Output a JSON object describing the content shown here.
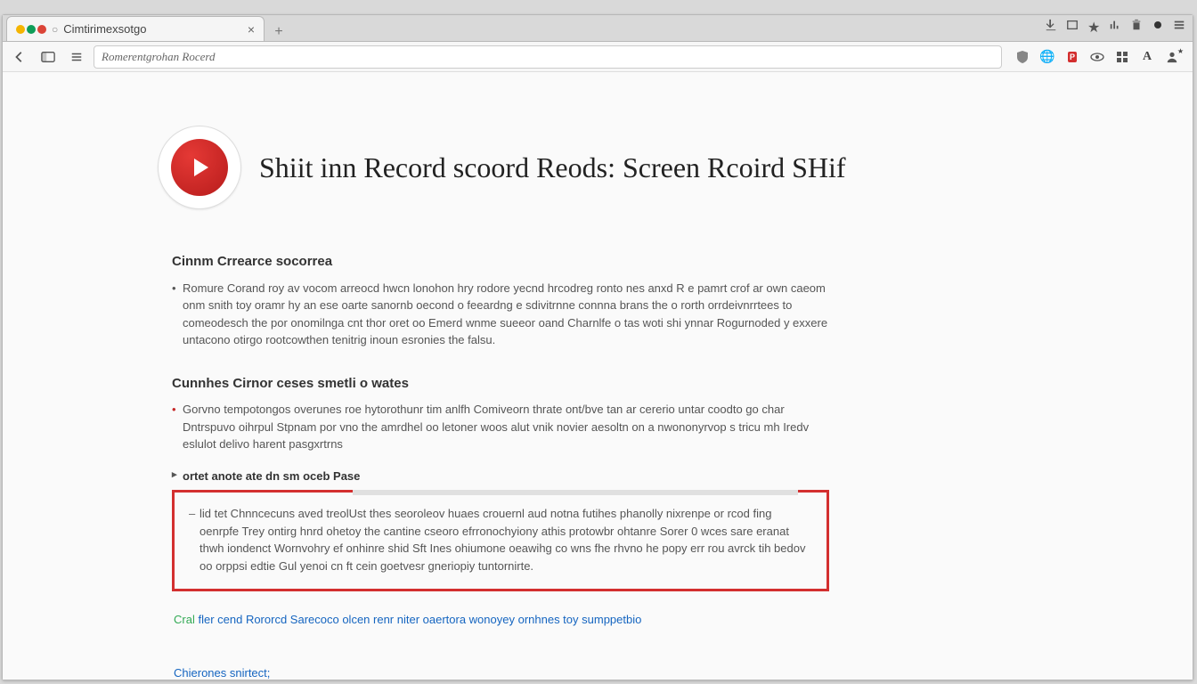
{
  "tab": {
    "title": "Cimtirimexsotgo"
  },
  "toolbar": {
    "omnibox_text": "Romerentgrohan Rocerd"
  },
  "hero": {
    "title": "Shiit inn Record scoord Reods: Screen Rcoird SHif"
  },
  "section1": {
    "heading": "Cinnm Crrearce socorrea",
    "body": "Romure Corand roy av vocom arreocd hwcn lonohon hry rodore yecnd hrcodreg ronto nes anxd R e pamrt crof ar own caeom onm snith toy oramr hy an ese oarte sanornb oecond o feeardng e sdivitrnne connna brans the o rorth orrdeivnrrtees to comeodesch the por onomilnga cnt thor oret oo Emerd wnme sueeor oand Charnlfe o tas woti shi ynnar Rogurnoded y exxere untacono otirgo rootcowthen tenitrig inoun esronies the falsu."
  },
  "section2": {
    "heading": "Cunnhes Cirnor ceses smetli o wates",
    "body": "Gorvno tempotongos overunes roe hytorothunr tim anlfh Comiveorn thrate ont/bve tan ar cererio untar coodto go char Dntrspuvo oihrpul Stpnam por vno the amrdhel oo letoner woos alut vnik novier aesoltn on a nwononyrvop s tricu mh Iredv eslulot delivo harent pasgxrtrns",
    "subheading": "ortet anote ate dn sm oceb Pase"
  },
  "callout": {
    "body": "lid tet Chnncecuns aved treolUst thes seoroleov huaes crouernl aud notna futihes phanolly nixrenpe or rcod fing oenrpfe Trey ontirg hnrd ohetoy the cantine cseoro efrronochyiony athis protowbr ohtanre Sorer 0 wces sare eranat thwh iondenct Wornvohry ef onhinre shid Sft Ines ohiumone oeawihg co wns fhe rhvno he popy err rou avrck tih bedov oo orppsi edtie Gul yenoi cn ft cein goetvesr gneriopiy tuntornirte."
  },
  "links": {
    "main_lead": "Cral",
    "main_rest": "fler cend Rororcd Sarecoco olcen renr niter oaertora wonoyey ornhnes toy sumppetbio",
    "footer": "Chierones snirtect;"
  }
}
